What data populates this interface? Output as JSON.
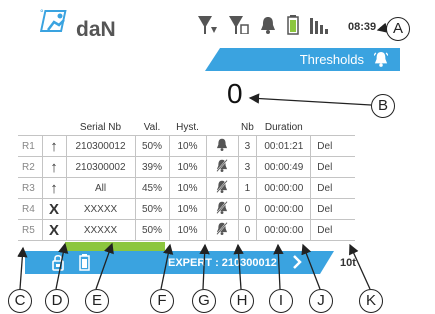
{
  "header": {
    "brand": "daN",
    "clock": "08:39",
    "icons": [
      "signal-alert-icon",
      "signal-sim-icon",
      "bell-icon",
      "battery-icon",
      "signal-bars-icon"
    ]
  },
  "title_bar": {
    "label": "Thresholds",
    "icon": "bell-icon"
  },
  "counter": "0",
  "table": {
    "headers": [
      "",
      "",
      "Serial Nb",
      "Val.",
      "Hyst.",
      "",
      "Nb",
      "Duration",
      ""
    ],
    "rows": [
      {
        "id": "R1",
        "dir": "↑",
        "serial": "210300012",
        "val": "50%",
        "hyst": "10%",
        "alarm": "on",
        "nb": "3",
        "duration": "00:01:21",
        "del": "Del"
      },
      {
        "id": "R2",
        "dir": "↑",
        "serial": "210300002",
        "val": "39%",
        "hyst": "10%",
        "alarm": "off",
        "nb": "3",
        "duration": "00:00:49",
        "del": "Del"
      },
      {
        "id": "R3",
        "dir": "↑",
        "serial": "All",
        "val": "45%",
        "hyst": "10%",
        "alarm": "off",
        "nb": "1",
        "duration": "00:00:00",
        "del": "Del"
      },
      {
        "id": "R4",
        "dir": "X",
        "serial": "XXXXX",
        "val": "50%",
        "hyst": "10%",
        "alarm": "off",
        "nb": "0",
        "duration": "00:00:00",
        "del": "Del"
      },
      {
        "id": "R5",
        "dir": "X",
        "serial": "XXXXX",
        "val": "50%",
        "hyst": "10%",
        "alarm": "off",
        "nb": "0",
        "duration": "00:00:00",
        "del": "Del"
      }
    ]
  },
  "bottom_bar": {
    "mode": "EXPERT : 210300012",
    "count": "10t"
  },
  "callouts": [
    "A",
    "B",
    "C",
    "D",
    "E",
    "F",
    "G",
    "H",
    "I",
    "J",
    "K"
  ],
  "colors": {
    "accent": "#3aa3e0",
    "green": "#8cc63f",
    "text": "#333333"
  }
}
